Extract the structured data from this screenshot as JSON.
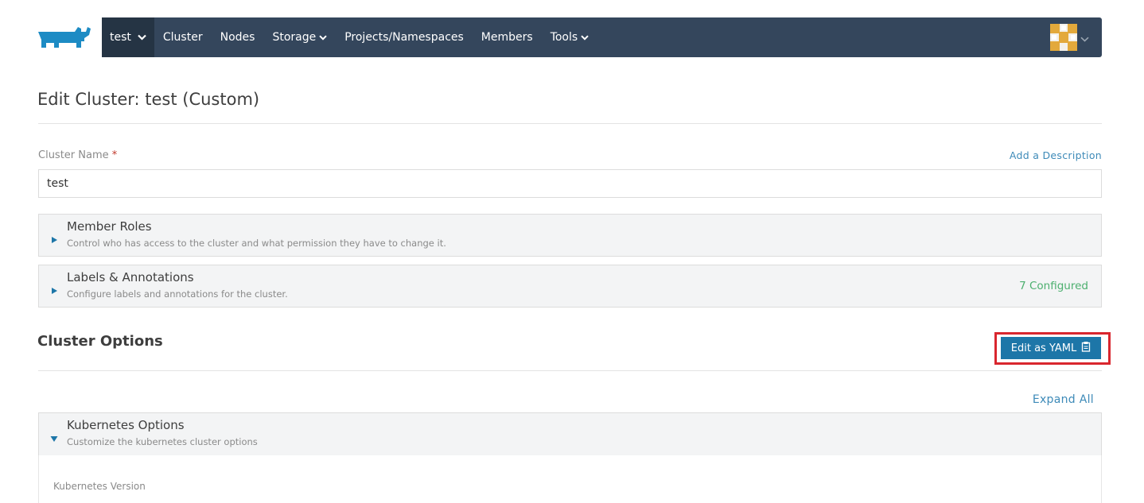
{
  "nav": {
    "cluster_name": "test",
    "items": [
      {
        "label": "Cluster",
        "dropdown": false
      },
      {
        "label": "Nodes",
        "dropdown": false
      },
      {
        "label": "Storage",
        "dropdown": true
      },
      {
        "label": "Projects/Namespaces",
        "dropdown": false
      },
      {
        "label": "Members",
        "dropdown": false
      },
      {
        "label": "Tools",
        "dropdown": true
      }
    ],
    "logo_icon": "rancher-logo-icon",
    "avatar_icon": "user-avatar-icon"
  },
  "page": {
    "title": "Edit Cluster: test (Custom)"
  },
  "cluster_name": {
    "label": "Cluster Name",
    "required_mark": "*",
    "value": "test",
    "add_description": "Add a Description"
  },
  "panels": {
    "member_roles": {
      "title": "Member Roles",
      "subtitle": "Control who has access to the cluster and what permission they have to change it."
    },
    "labels": {
      "title": "Labels & Annotations",
      "subtitle": "Configure labels and annotations for the cluster.",
      "status": "7 Configured"
    },
    "kubernetes": {
      "title": "Kubernetes Options",
      "subtitle": "Customize the kubernetes cluster options",
      "field_label": "Kubernetes Version"
    }
  },
  "cluster_options": {
    "title": "Cluster Options",
    "edit_yaml_label": "Edit as YAML",
    "expand_all": "Expand All"
  },
  "colors": {
    "navbar": "#34465c",
    "nav_active": "#253444",
    "primary": "#1d76a8",
    "highlight": "#d9262e",
    "success": "#4caf6e"
  }
}
